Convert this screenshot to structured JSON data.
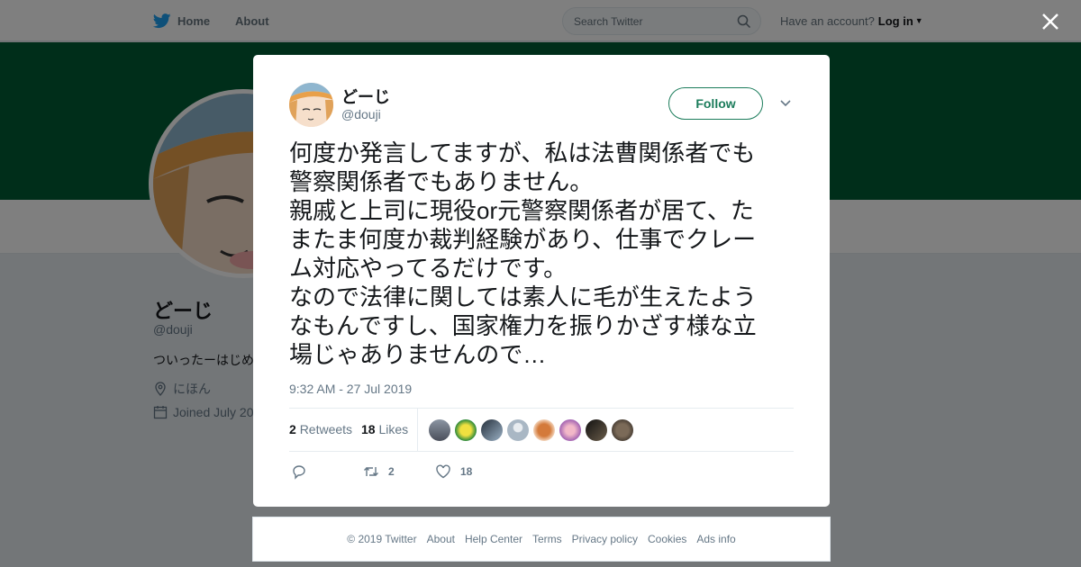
{
  "nav": {
    "home_label": "Home",
    "about_label": "About",
    "search_placeholder": "Search Twitter",
    "account_prompt": "Have an account?",
    "login_label": "Log in",
    "brand_color": "#1da1f2"
  },
  "profile": {
    "name": "どーじ",
    "handle": "@douji",
    "bio": "ついったーはじめ",
    "location": "にほん",
    "joined": "Joined July 20",
    "banner_color": "#005c35"
  },
  "tweet": {
    "author_name": "どーじ",
    "author_handle": "@douji",
    "follow_label": "Follow",
    "text_lines": [
      "何度か発言してますが、私は法曹関係者でも",
      "警察関係者でもありません。",
      "親戚と上司に現役or元警察関係者が居て、た",
      "またま何度か裁判経験があり、仕事でクレー",
      "ム対応やってるだけです。",
      "なので法律に関しては素人に毛が生えたよう",
      "なもんですし、国家権力を振りかざす様な立",
      "場じゃありませんので…"
    ],
    "timestamp": "9:32 AM - 27 Jul 2019",
    "retweet_count": "2",
    "retweets_label": "Retweets",
    "like_count": "18",
    "likes_label": "Likes",
    "action_retweet_count": "2",
    "action_like_count": "18",
    "accent_color": "#1b7c5b"
  },
  "footer": {
    "links": [
      "© 2019 Twitter",
      "About",
      "Help Center",
      "Terms",
      "Privacy policy",
      "Cookies",
      "Ads info"
    ]
  }
}
